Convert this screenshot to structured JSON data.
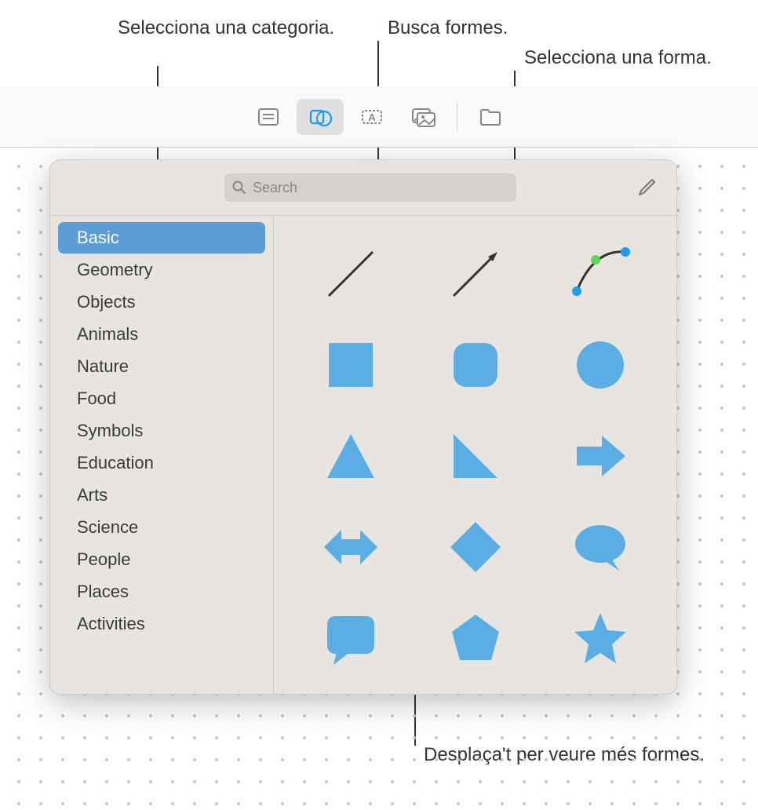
{
  "callouts": {
    "select_category": "Selecciona una categoria.",
    "search_shapes": "Busca formes.",
    "select_shape": "Selecciona una forma.",
    "scroll_more": "Desplaça't per veure més formes."
  },
  "toolbar": {
    "items": [
      {
        "name": "text-style",
        "active": false
      },
      {
        "name": "shapes",
        "active": true
      },
      {
        "name": "textbox",
        "active": false
      },
      {
        "name": "media",
        "active": false
      },
      {
        "name": "folder",
        "active": false
      }
    ]
  },
  "search": {
    "placeholder": "Search",
    "value": ""
  },
  "categories": [
    {
      "label": "Basic",
      "selected": true
    },
    {
      "label": "Geometry",
      "selected": false
    },
    {
      "label": "Objects",
      "selected": false
    },
    {
      "label": "Animals",
      "selected": false
    },
    {
      "label": "Nature",
      "selected": false
    },
    {
      "label": "Food",
      "selected": false
    },
    {
      "label": "Symbols",
      "selected": false
    },
    {
      "label": "Education",
      "selected": false
    },
    {
      "label": "Arts",
      "selected": false
    },
    {
      "label": "Science",
      "selected": false
    },
    {
      "label": "People",
      "selected": false
    },
    {
      "label": "Places",
      "selected": false
    },
    {
      "label": "Activities",
      "selected": false
    }
  ],
  "shapes": [
    {
      "name": "line"
    },
    {
      "name": "arrow-line"
    },
    {
      "name": "curve"
    },
    {
      "name": "square"
    },
    {
      "name": "rounded-square"
    },
    {
      "name": "circle"
    },
    {
      "name": "triangle"
    },
    {
      "name": "right-triangle"
    },
    {
      "name": "arrow-right"
    },
    {
      "name": "arrow-bidirectional"
    },
    {
      "name": "diamond"
    },
    {
      "name": "speech-bubble-oval"
    },
    {
      "name": "speech-bubble-rect"
    },
    {
      "name": "pentagon"
    },
    {
      "name": "star"
    }
  ],
  "colors": {
    "shape_fill": "#5aaee3",
    "accent": "#5b9dd6"
  }
}
